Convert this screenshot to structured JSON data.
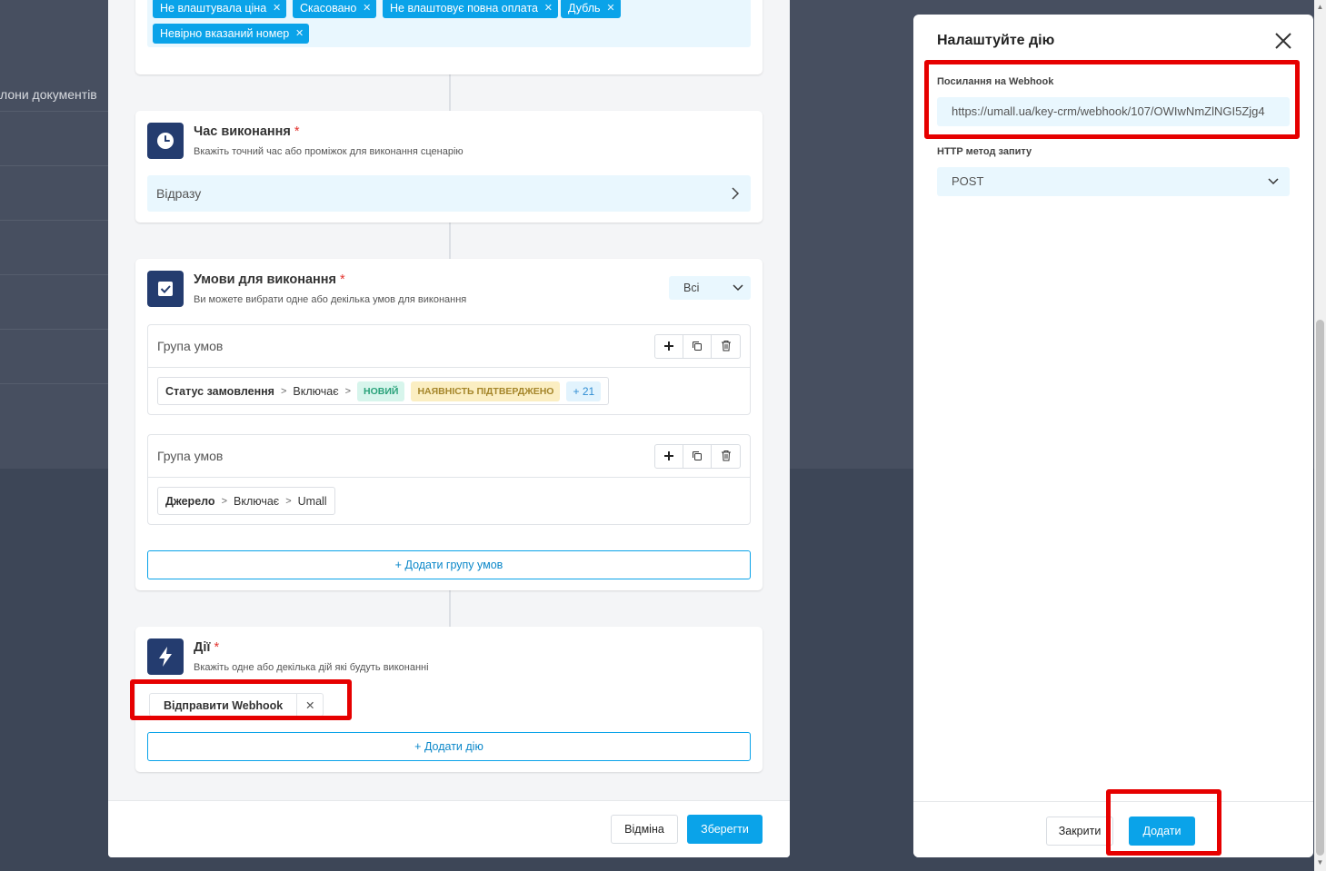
{
  "background": {
    "label": "лони документів"
  },
  "status_tags": [
    "Не влаштувала ціна",
    "Скасовано",
    "Не влаштовує повна оплата",
    "Дубль",
    "Невірно вказаний номер"
  ],
  "time_card": {
    "title": "Час виконання",
    "required": "*",
    "subtitle": "Вкажіть точний час або проміжок для виконання сценарію",
    "value": "Відразу"
  },
  "conditions_card": {
    "title": "Умови для виконання",
    "required": "*",
    "subtitle": "Ви можете вибрати одне або декілька умов для виконання",
    "match_select": "Всі",
    "groups": [
      {
        "title": "Група умов",
        "field": "Статус замовлення",
        "operator": "Включає",
        "badges": [
          "НОВИЙ",
          "НАЯВНІСТЬ ПІДТВЕРДЖЕНО"
        ],
        "more": "+ 21"
      },
      {
        "title": "Група умов",
        "field": "Джерело",
        "operator": "Включає",
        "value": "Umall"
      }
    ],
    "add_group_label": "Додати групу умов"
  },
  "actions_card": {
    "title": "Дії",
    "required": "*",
    "subtitle": "Вкажіть одне або декілька дій які будуть виконанні",
    "chip_label": "Відправити Webhook",
    "add_action_label": "Додати дію"
  },
  "footer": {
    "cancel_label": "Відміна",
    "save_label": "Зберегти"
  },
  "panel": {
    "title": "Налаштуйте дію",
    "webhook_label": "Посилання на Webhook",
    "webhook_value": "https://umall.ua/key-crm/webhook/107/OWIwNmZlNGI5Zjg4",
    "method_label": "HTTP метод запиту",
    "method_value": "POST",
    "close_label": "Закрити",
    "add_label": "Додати"
  },
  "colors": {
    "accent": "#0aa3e9",
    "icon_bg": "#243c6f",
    "highlight": "#e60000"
  }
}
